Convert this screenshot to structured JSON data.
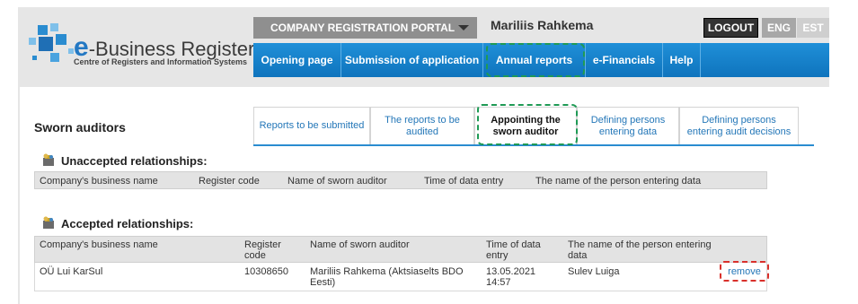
{
  "logo": {
    "title_e": "e",
    "title_rest": "-Business Register",
    "subtitle": "Centre of Registers and Information Systems"
  },
  "header": {
    "portal_label": "COMPANY REGISTRATION PORTAL",
    "user_name": "Mariliis Rahkema",
    "logout_label": "LOGOUT",
    "lang_eng": "ENG",
    "lang_est": "EST"
  },
  "nav": {
    "items": [
      "Opening page",
      "Submission of application",
      "Annual reports",
      "e-Financials",
      "Help"
    ]
  },
  "page": {
    "title": "Sworn auditors"
  },
  "tabs": [
    "Reports to be submitted",
    "The reports to be audited",
    "Appointing the sworn auditor",
    "Defining persons entering data",
    "Defining persons entering audit decisions"
  ],
  "unaccepted": {
    "title": "Unaccepted relationships:",
    "headers": [
      "Company's business name",
      "Register code",
      "Name of sworn auditor",
      "Time of data entry",
      "The name of the person entering data"
    ]
  },
  "accepted": {
    "title": "Accepted relationships:",
    "headers": [
      "Company's business name",
      "Register code",
      "Name of sworn auditor",
      "Time of data entry",
      "The name of the person entering data"
    ],
    "rows": [
      {
        "company": "OÜ Lui KarSul",
        "code": "10308650",
        "auditor": "Mariliis Rahkema (Aktsiaselts BDO Eesti)",
        "time": "13.05.2021 14:57",
        "entered_by": "Sulev Luiga",
        "action": "remove"
      }
    ]
  },
  "colors": {
    "nav_blue": "#1f8fd8",
    "link_blue": "#2477b8",
    "highlight_green": "#1f9a55",
    "highlight_red": "#d9302b"
  }
}
